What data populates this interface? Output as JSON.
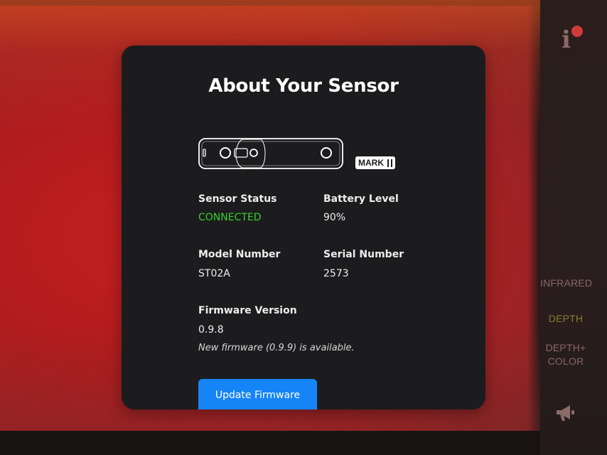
{
  "modal": {
    "title": "About Your Sensor",
    "badge": "MARK",
    "fields": {
      "sensor_status": {
        "label": "Sensor Status",
        "value": "CONNECTED"
      },
      "battery_level": {
        "label": "Battery Level",
        "value": "90%"
      },
      "model_number": {
        "label": "Model Number",
        "value": "ST02A"
      },
      "serial_number": {
        "label": "Serial Number",
        "value": "2573"
      },
      "firmware_version": {
        "label": "Firmware Version",
        "value": "0.9.8"
      }
    },
    "firmware_note": "New firmware (0.9.9) is available.",
    "update_button": "Update Firmware"
  },
  "sidebar": {
    "info_icon": "info-icon",
    "modes": [
      {
        "label": "INFRARED",
        "color": "#8a6762"
      },
      {
        "label": "DEPTH",
        "color": "#8d7b2d"
      },
      {
        "label": "DEPTH+\nCOLOR",
        "color": "#8a6762"
      }
    ],
    "megaphone_icon": "megaphone-icon"
  },
  "colors": {
    "accent": "#1584f7",
    "connected": "#35d02b",
    "panel": "#1c1c1e"
  }
}
